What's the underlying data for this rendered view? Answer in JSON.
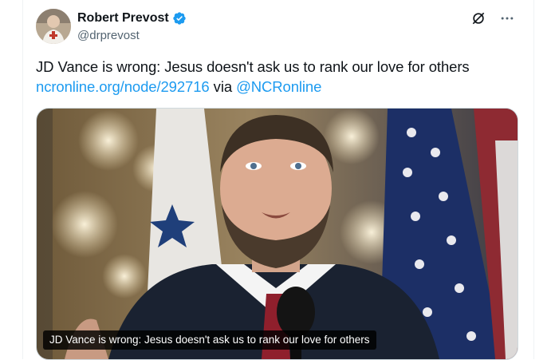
{
  "author": {
    "name": "Robert Prevost",
    "handle": "@drprevost",
    "verified_icon": "verified-badge-icon"
  },
  "header_icons": [
    "grok-icon",
    "more-icon"
  ],
  "tweet": {
    "text": "JD Vance is wrong: Jesus doesn't ask us to rank our love for others",
    "link": "ncronline.org/node/292716",
    "via": " via ",
    "mention": "@NCRonline"
  },
  "media": {
    "caption": "JD Vance is wrong: Jesus doesn't ask us to rank our love for others"
  },
  "colors": {
    "accent": "#1d9bf0",
    "text": "#0f1419",
    "secondary": "#536471"
  }
}
